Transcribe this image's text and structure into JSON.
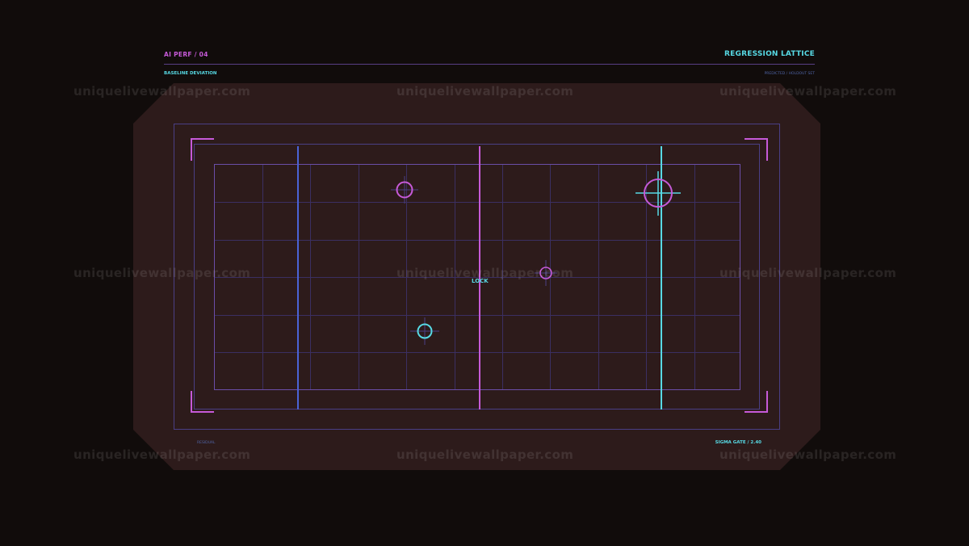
{
  "header": {
    "left_label": "AI PERF / 04",
    "title": "REGRESSION LATTICE",
    "sub_left": "BASELINE DEVIATION",
    "sub_right": "PREDICTED / HOLDOUT SET"
  },
  "footer": {
    "left_label": "RESIDUAL",
    "right_label": "SIGMA GATE / 2.40"
  },
  "lattice": {
    "lock_label": "LOCK"
  },
  "watermark": {
    "text": "uniquelivewallpaper.com"
  },
  "colors": {
    "background": "#110c0b",
    "panel": "#2d1b1b",
    "magenta": "#c65ad8",
    "cyan": "#57d9e4",
    "blue": "#4a63d6",
    "grid": "#3b2f62"
  }
}
